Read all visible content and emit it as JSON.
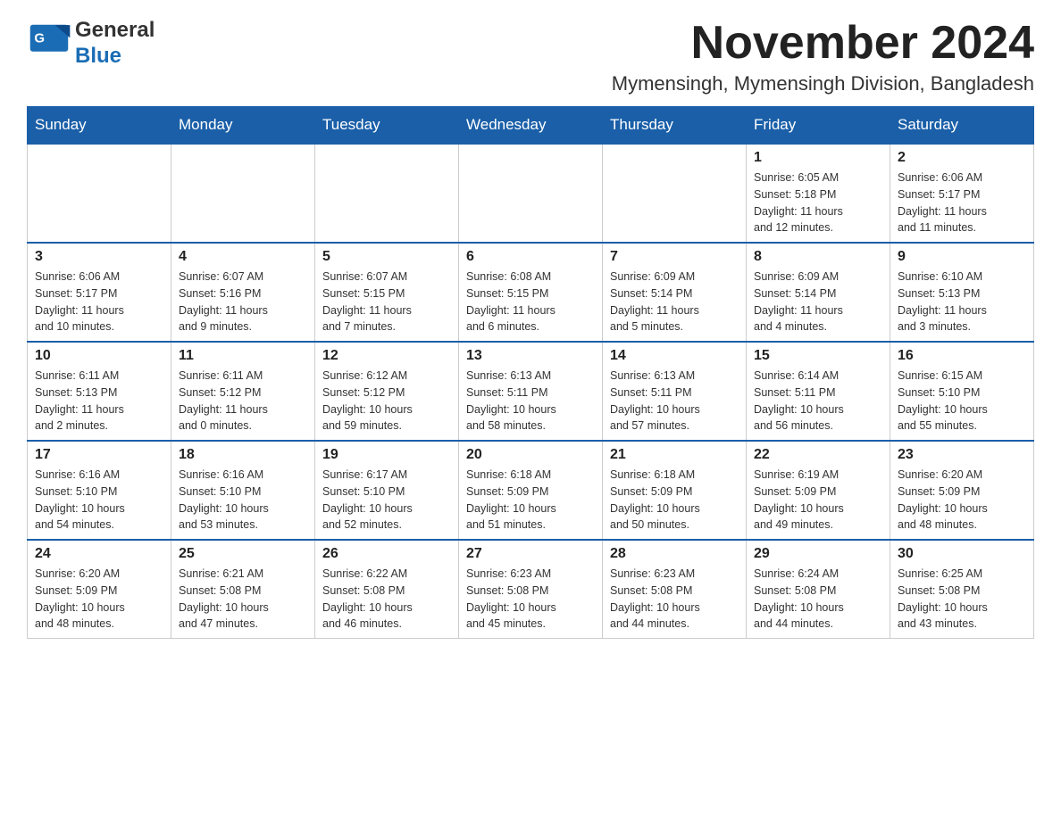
{
  "header": {
    "logo_general": "General",
    "logo_blue": "Blue",
    "month_title": "November 2024",
    "location": "Mymensingh, Mymensingh Division, Bangladesh"
  },
  "weekdays": [
    "Sunday",
    "Monday",
    "Tuesday",
    "Wednesday",
    "Thursday",
    "Friday",
    "Saturday"
  ],
  "weeks": [
    {
      "days": [
        {
          "number": "",
          "info": ""
        },
        {
          "number": "",
          "info": ""
        },
        {
          "number": "",
          "info": ""
        },
        {
          "number": "",
          "info": ""
        },
        {
          "number": "",
          "info": ""
        },
        {
          "number": "1",
          "info": "Sunrise: 6:05 AM\nSunset: 5:18 PM\nDaylight: 11 hours\nand 12 minutes."
        },
        {
          "number": "2",
          "info": "Sunrise: 6:06 AM\nSunset: 5:17 PM\nDaylight: 11 hours\nand 11 minutes."
        }
      ]
    },
    {
      "days": [
        {
          "number": "3",
          "info": "Sunrise: 6:06 AM\nSunset: 5:17 PM\nDaylight: 11 hours\nand 10 minutes."
        },
        {
          "number": "4",
          "info": "Sunrise: 6:07 AM\nSunset: 5:16 PM\nDaylight: 11 hours\nand 9 minutes."
        },
        {
          "number": "5",
          "info": "Sunrise: 6:07 AM\nSunset: 5:15 PM\nDaylight: 11 hours\nand 7 minutes."
        },
        {
          "number": "6",
          "info": "Sunrise: 6:08 AM\nSunset: 5:15 PM\nDaylight: 11 hours\nand 6 minutes."
        },
        {
          "number": "7",
          "info": "Sunrise: 6:09 AM\nSunset: 5:14 PM\nDaylight: 11 hours\nand 5 minutes."
        },
        {
          "number": "8",
          "info": "Sunrise: 6:09 AM\nSunset: 5:14 PM\nDaylight: 11 hours\nand 4 minutes."
        },
        {
          "number": "9",
          "info": "Sunrise: 6:10 AM\nSunset: 5:13 PM\nDaylight: 11 hours\nand 3 minutes."
        }
      ]
    },
    {
      "days": [
        {
          "number": "10",
          "info": "Sunrise: 6:11 AM\nSunset: 5:13 PM\nDaylight: 11 hours\nand 2 minutes."
        },
        {
          "number": "11",
          "info": "Sunrise: 6:11 AM\nSunset: 5:12 PM\nDaylight: 11 hours\nand 0 minutes."
        },
        {
          "number": "12",
          "info": "Sunrise: 6:12 AM\nSunset: 5:12 PM\nDaylight: 10 hours\nand 59 minutes."
        },
        {
          "number": "13",
          "info": "Sunrise: 6:13 AM\nSunset: 5:11 PM\nDaylight: 10 hours\nand 58 minutes."
        },
        {
          "number": "14",
          "info": "Sunrise: 6:13 AM\nSunset: 5:11 PM\nDaylight: 10 hours\nand 57 minutes."
        },
        {
          "number": "15",
          "info": "Sunrise: 6:14 AM\nSunset: 5:11 PM\nDaylight: 10 hours\nand 56 minutes."
        },
        {
          "number": "16",
          "info": "Sunrise: 6:15 AM\nSunset: 5:10 PM\nDaylight: 10 hours\nand 55 minutes."
        }
      ]
    },
    {
      "days": [
        {
          "number": "17",
          "info": "Sunrise: 6:16 AM\nSunset: 5:10 PM\nDaylight: 10 hours\nand 54 minutes."
        },
        {
          "number": "18",
          "info": "Sunrise: 6:16 AM\nSunset: 5:10 PM\nDaylight: 10 hours\nand 53 minutes."
        },
        {
          "number": "19",
          "info": "Sunrise: 6:17 AM\nSunset: 5:10 PM\nDaylight: 10 hours\nand 52 minutes."
        },
        {
          "number": "20",
          "info": "Sunrise: 6:18 AM\nSunset: 5:09 PM\nDaylight: 10 hours\nand 51 minutes."
        },
        {
          "number": "21",
          "info": "Sunrise: 6:18 AM\nSunset: 5:09 PM\nDaylight: 10 hours\nand 50 minutes."
        },
        {
          "number": "22",
          "info": "Sunrise: 6:19 AM\nSunset: 5:09 PM\nDaylight: 10 hours\nand 49 minutes."
        },
        {
          "number": "23",
          "info": "Sunrise: 6:20 AM\nSunset: 5:09 PM\nDaylight: 10 hours\nand 48 minutes."
        }
      ]
    },
    {
      "days": [
        {
          "number": "24",
          "info": "Sunrise: 6:20 AM\nSunset: 5:09 PM\nDaylight: 10 hours\nand 48 minutes."
        },
        {
          "number": "25",
          "info": "Sunrise: 6:21 AM\nSunset: 5:08 PM\nDaylight: 10 hours\nand 47 minutes."
        },
        {
          "number": "26",
          "info": "Sunrise: 6:22 AM\nSunset: 5:08 PM\nDaylight: 10 hours\nand 46 minutes."
        },
        {
          "number": "27",
          "info": "Sunrise: 6:23 AM\nSunset: 5:08 PM\nDaylight: 10 hours\nand 45 minutes."
        },
        {
          "number": "28",
          "info": "Sunrise: 6:23 AM\nSunset: 5:08 PM\nDaylight: 10 hours\nand 44 minutes."
        },
        {
          "number": "29",
          "info": "Sunrise: 6:24 AM\nSunset: 5:08 PM\nDaylight: 10 hours\nand 44 minutes."
        },
        {
          "number": "30",
          "info": "Sunrise: 6:25 AM\nSunset: 5:08 PM\nDaylight: 10 hours\nand 43 minutes."
        }
      ]
    }
  ]
}
